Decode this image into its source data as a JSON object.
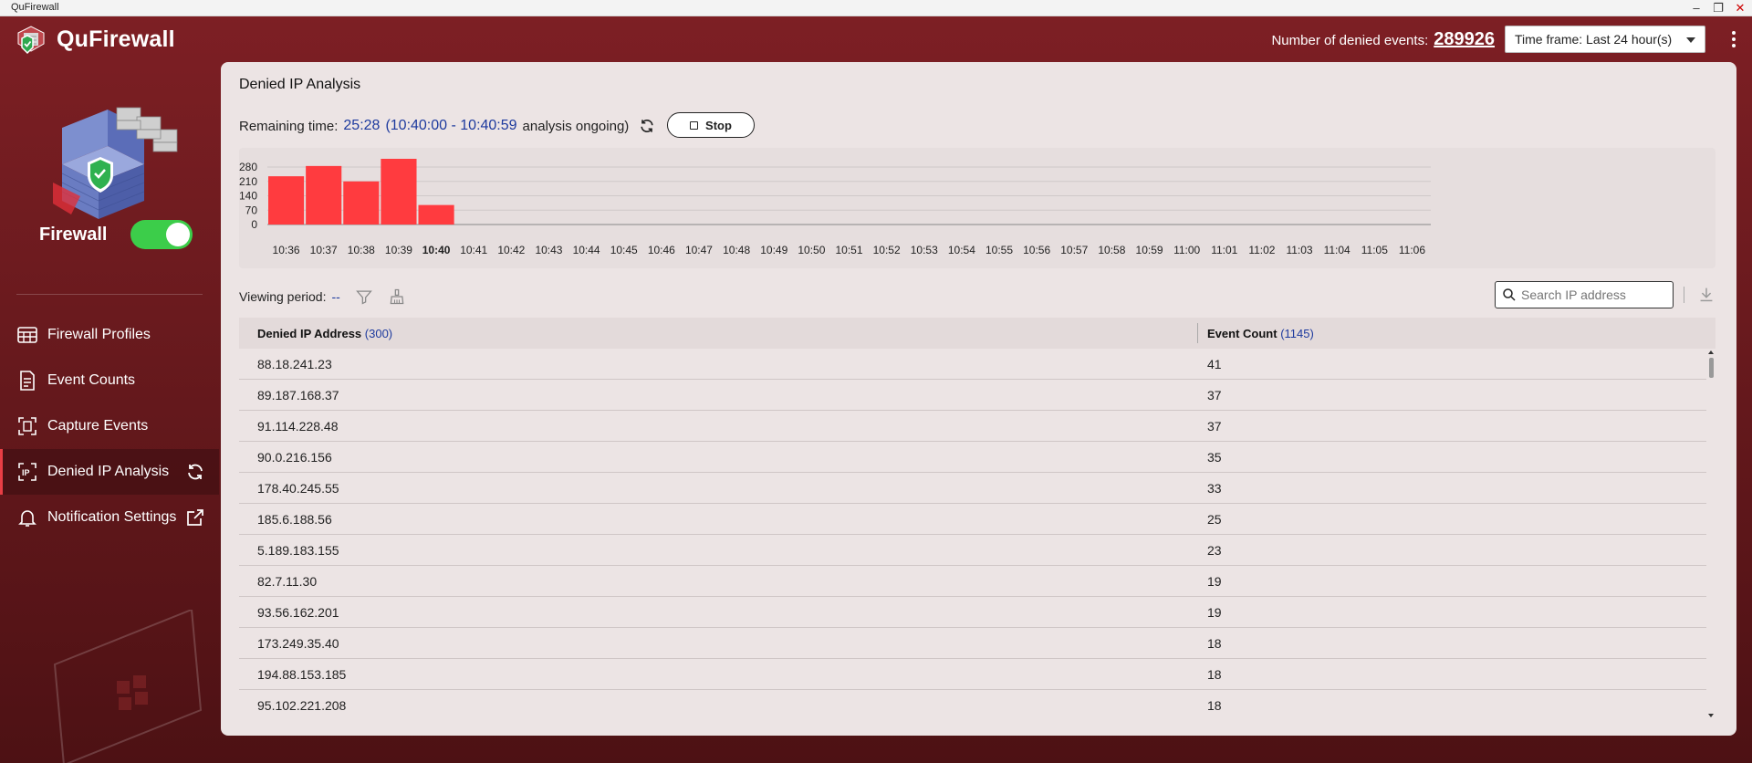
{
  "window": {
    "title": "QuFirewall"
  },
  "app": {
    "name": "QuFirewall"
  },
  "header": {
    "denied_label": "Number of denied events:",
    "denied_count": "289926",
    "timeframe_label": "Time frame: Last 24 hour(s)"
  },
  "sidebar": {
    "firewall_label": "Firewall",
    "firewall_enabled": true,
    "items": [
      {
        "label": "Firewall Profiles",
        "icon": "grid-table-icon",
        "active": false
      },
      {
        "label": "Event Counts",
        "icon": "document-icon",
        "active": false
      },
      {
        "label": "Capture Events",
        "icon": "capture-frame-icon",
        "active": false
      },
      {
        "label": "Denied IP Analysis",
        "icon": "ip-icon",
        "active": true
      },
      {
        "label": "Notification Settings",
        "icon": "bell-icon",
        "active": false
      }
    ]
  },
  "main": {
    "title": "Denied IP Analysis",
    "remaining_label": "Remaining time:",
    "remaining_time": "25:28",
    "remaining_range": "(10:40:00 - 10:40:59",
    "remaining_status": "analysis ongoing)",
    "stop_label": "Stop",
    "viewing_label": "Viewing period:",
    "viewing_value": "--",
    "search_placeholder": "Search IP address",
    "table": {
      "col1_label": "Denied IP Address",
      "col1_count": "(300)",
      "col2_label": "Event Count",
      "col2_count": "(1145)",
      "rows": [
        {
          "ip": "88.18.241.23",
          "count": "41"
        },
        {
          "ip": "89.187.168.37",
          "count": "37"
        },
        {
          "ip": "91.114.228.48",
          "count": "37"
        },
        {
          "ip": "90.0.216.156",
          "count": "35"
        },
        {
          "ip": "178.40.245.55",
          "count": "33"
        },
        {
          "ip": "185.6.188.56",
          "count": "25"
        },
        {
          "ip": "5.189.183.155",
          "count": "23"
        },
        {
          "ip": "82.7.11.30",
          "count": "19"
        },
        {
          "ip": "93.56.162.201",
          "count": "19"
        },
        {
          "ip": "173.249.35.40",
          "count": "18"
        },
        {
          "ip": "194.88.153.185",
          "count": "18"
        },
        {
          "ip": "95.102.221.208",
          "count": "18"
        }
      ]
    }
  },
  "chart_data": {
    "type": "bar",
    "categories": [
      "10:36",
      "10:37",
      "10:38",
      "10:39",
      "10:40",
      "10:41",
      "10:42",
      "10:43",
      "10:44",
      "10:45",
      "10:46",
      "10:47",
      "10:48",
      "10:49",
      "10:50",
      "10:51",
      "10:52",
      "10:53",
      "10:54",
      "10:55",
      "10:56",
      "10:57",
      "10:58",
      "10:59",
      "11:00",
      "11:01",
      "11:02",
      "11:03",
      "11:04",
      "11:05",
      "11:06"
    ],
    "values": [
      235,
      285,
      210,
      320,
      95,
      null,
      null,
      null,
      null,
      null,
      null,
      null,
      null,
      null,
      null,
      null,
      null,
      null,
      null,
      null,
      null,
      null,
      null,
      null,
      null,
      null,
      null,
      null,
      null,
      null,
      null
    ],
    "highlight_category": "10:40",
    "yticks": [
      0,
      70,
      140,
      210,
      280
    ],
    "ylim": [
      0,
      320
    ],
    "grid": true,
    "bar_color": "#ff3b3f"
  },
  "colors": {
    "accent": "#e83e45",
    "link": "#1d3a9e",
    "toggle_on": "#3ccd4a"
  }
}
